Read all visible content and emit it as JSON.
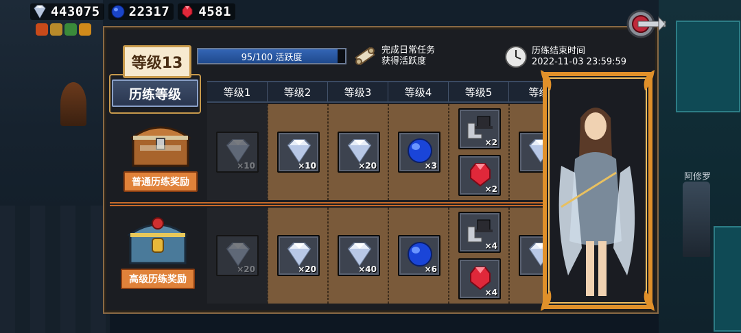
{
  "currency": {
    "diamonds": "443075",
    "sapphires": "22317",
    "rubies": "4581"
  },
  "level": {
    "badge": "等级13",
    "title": "历练等级"
  },
  "activity": {
    "progress_text": "95/100 活跃度",
    "progress_fraction": 0.95
  },
  "task": {
    "line1": "完成日常任务",
    "line2": "获得活跃度"
  },
  "timer": {
    "label": "历练结束时间",
    "end_time": "2022-11-03 23:59:59"
  },
  "columns": [
    "等级1",
    "等级2",
    "等级3",
    "等级4",
    "等级5",
    "等级"
  ],
  "rows": {
    "normal": {
      "label": "普通历练奖励",
      "cells": [
        {
          "items": [
            {
              "icon": "diamond",
              "qty": "×10"
            }
          ],
          "locked": true
        },
        {
          "items": [
            {
              "icon": "diamond",
              "qty": "×10"
            }
          ]
        },
        {
          "items": [
            {
              "icon": "diamond",
              "qty": "×20"
            }
          ]
        },
        {
          "items": [
            {
              "icon": "sapphire",
              "qty": "×3"
            }
          ]
        },
        {
          "items": [
            {
              "icon": "hat-boots",
              "qty": "×2"
            },
            {
              "icon": "ruby",
              "qty": "×2"
            }
          ]
        },
        {
          "items": [
            {
              "icon": "diamond",
              "qty": ""
            }
          ]
        }
      ]
    },
    "advanced": {
      "label": "高级历练奖励",
      "cells": [
        {
          "items": [
            {
              "icon": "diamond",
              "qty": "×20"
            }
          ],
          "locked": true
        },
        {
          "items": [
            {
              "icon": "diamond",
              "qty": "×20"
            }
          ]
        },
        {
          "items": [
            {
              "icon": "diamond",
              "qty": "×40"
            }
          ]
        },
        {
          "items": [
            {
              "icon": "sapphire",
              "qty": "×6"
            }
          ]
        },
        {
          "items": [
            {
              "icon": "hat-boots",
              "qty": "×4"
            },
            {
              "icon": "ruby",
              "qty": "×4"
            }
          ]
        },
        {
          "items": [
            {
              "icon": "diamond",
              "qty": ""
            }
          ]
        }
      ]
    }
  },
  "npc_label": "阿修罗",
  "colors": {
    "panel_border": "#8a6a45",
    "accent_orange": "#e0823a",
    "progress_blue": "#3465b5"
  }
}
